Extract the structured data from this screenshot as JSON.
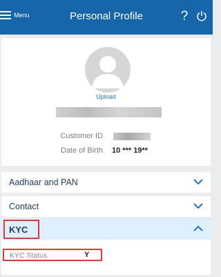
{
  "header": {
    "menu_label": "Menu",
    "title": "Personal Profile",
    "help_icon": "question-icon",
    "power_icon": "power-icon",
    "color": "#1565a8"
  },
  "profile": {
    "avatar_icon": "user-avatar-icon",
    "upload_label": "Upload",
    "customer_id_label": "Customer ID",
    "dob_label": "Date of Birth",
    "dob_value": "10 *** 19**"
  },
  "sections": {
    "aadhaar_label": "Aadhaar and PAN",
    "contact_label": "Contact",
    "kyc_label": "KYC"
  },
  "kyc": {
    "status_label": "KYC Status",
    "status_value": "Y"
  },
  "colors": {
    "accent": "#1f74c8",
    "highlight_outline": "#e53935",
    "active_section_bg": "#ddeefc"
  }
}
